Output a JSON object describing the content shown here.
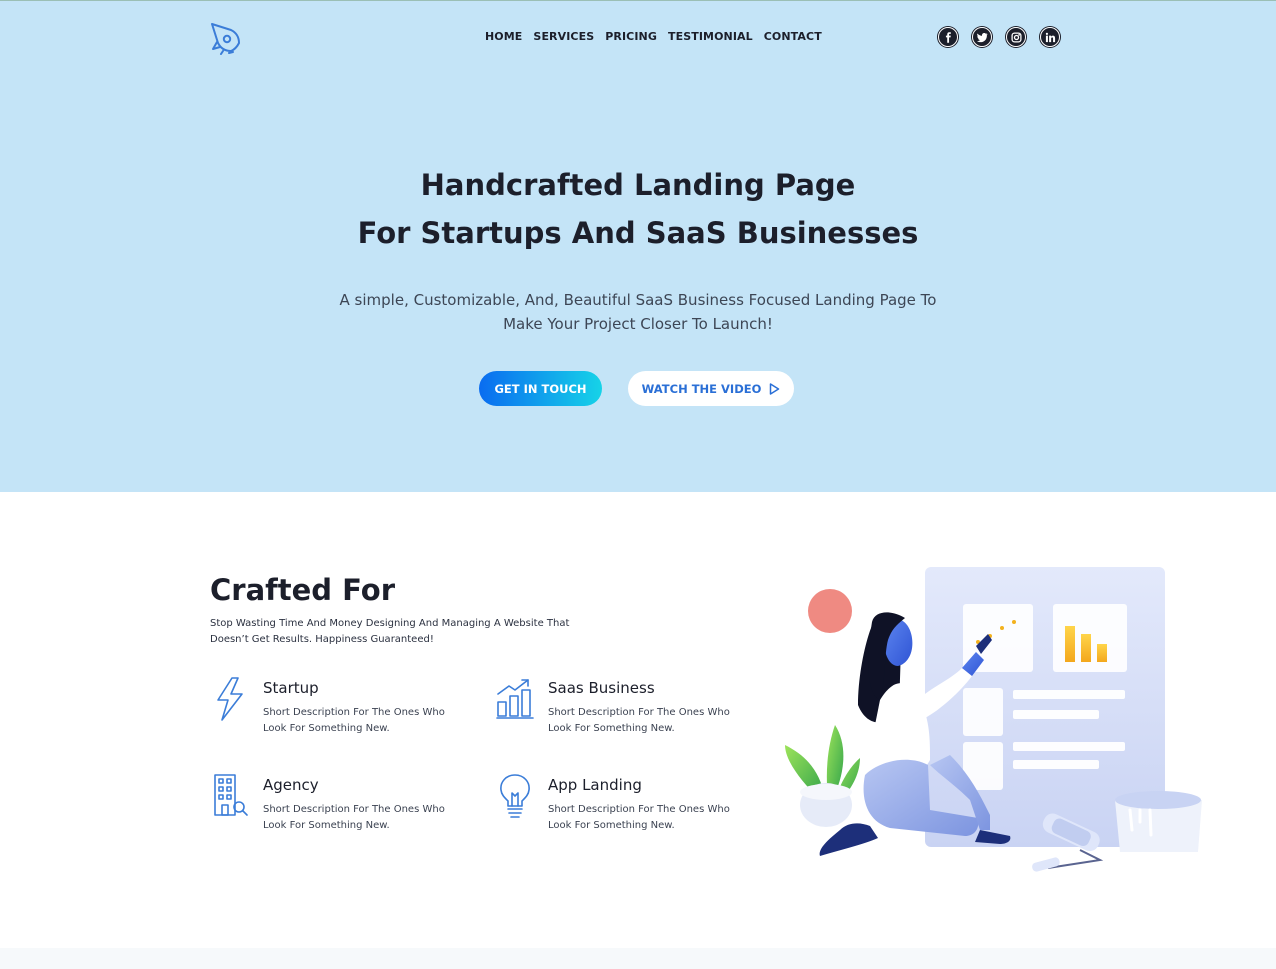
{
  "header": {
    "nav": [
      "HOME",
      "SERVICES",
      "PRICING",
      "TESTIMONIAL",
      "CONTACT"
    ],
    "social": [
      "facebook-icon",
      "twitter-icon",
      "instagram-icon",
      "linkedin-icon"
    ],
    "logo_icon": "rocket-icon"
  },
  "hero": {
    "title_line1": "Handcrafted Landing Page",
    "title_line2": "For Startups And SaaS Businesses",
    "subtitle_line1": "A simple, Customizable, And, Beautiful SaaS Business Focused Landing Page To",
    "subtitle_line2": "Make Your Project Closer To Launch!",
    "cta_primary": "GET IN TOUCH",
    "cta_secondary": "WATCH THE VIDEO",
    "cta_secondary_icon": "play-icon"
  },
  "crafted": {
    "title": "Crafted For",
    "desc_line1": "Stop Wasting Time And Money Designing And Managing A Website That",
    "desc_line2": "Doesn’t Get Results. Happiness Guaranteed!",
    "features": [
      {
        "name": "Startup",
        "icon": "lightning-icon",
        "desc_line1": "Short Description For The Ones Who",
        "desc_line2": "Look For Something New."
      },
      {
        "name": "Saas Business",
        "icon": "bar-chart-icon",
        "desc_line1": "Short Description For The Ones Who",
        "desc_line2": "Look For Something New."
      },
      {
        "name": "Agency",
        "icon": "building-icon",
        "desc_line1": "Short Description For The Ones Who",
        "desc_line2": "Look For Something New."
      },
      {
        "name": "App Landing",
        "icon": "lightbulb-icon",
        "desc_line1": "Short Description For The Ones Who",
        "desc_line2": "Look For Something New."
      }
    ]
  },
  "colors": {
    "hero_bg": "#c4e4f7",
    "dark_text": "#1c1f2b",
    "accent_blue": "#2a6fd6",
    "gradient_start": "#0a6cf0",
    "gradient_end": "#16d3e8"
  }
}
